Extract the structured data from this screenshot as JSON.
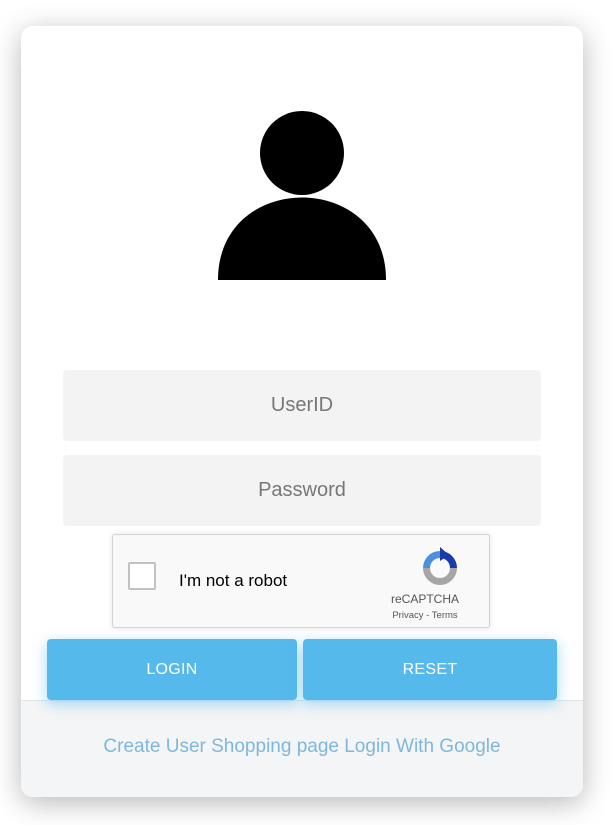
{
  "login_form": {
    "userid_placeholder": "UserID",
    "password_placeholder": "Password",
    "login_label": "LOGIN",
    "reset_label": "RESET",
    "footer_link": "Create User Shopping page Login With Google"
  },
  "recaptcha": {
    "label": "I'm not a robot",
    "brand": "reCAPTCHA",
    "privacy": "Privacy",
    "separator": " - ",
    "terms": "Terms"
  },
  "icons": {
    "avatar": "user-silhouette-icon",
    "recaptcha_logo": "recaptcha-logo-icon"
  },
  "colors": {
    "accent": "#56b9ec",
    "link": "#7fb7dc",
    "field_bg": "#f3f3f3",
    "footer_bg": "#f4f5f6"
  }
}
